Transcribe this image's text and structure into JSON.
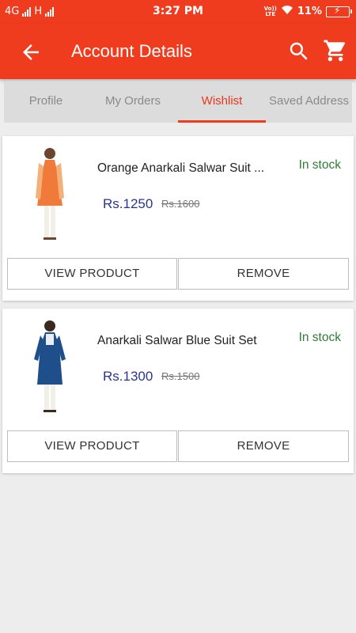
{
  "status_bar": {
    "network_left": "4G",
    "network_right": "H",
    "time": "3:27 PM",
    "volte_top": "Vo))",
    "volte_bottom": "LTE",
    "battery": "11%"
  },
  "app_bar": {
    "title": "Account Details",
    "back_icon": "arrow-back-icon",
    "search_icon": "search-icon",
    "cart_icon": "shopping-cart-icon",
    "color": "#f03c1e"
  },
  "tabs": [
    {
      "label": "Profile",
      "active": false
    },
    {
      "label": "My Orders",
      "active": false
    },
    {
      "label": "Wishlist",
      "active": true
    },
    {
      "label": "Saved Address",
      "active": false
    }
  ],
  "wishlist": [
    {
      "name": "Orange Anarkali Salwar Suit ...",
      "stock": "In stock",
      "price": "Rs.1250",
      "old_price": "Rs.1600",
      "view_label": "VIEW PRODUCT",
      "remove_label": "REMOVE",
      "image_color": "#f07a3a"
    },
    {
      "name": "Anarkali Salwar Blue Suit Set",
      "stock": "In stock",
      "price": "Rs.1300",
      "old_price": "Rs.1500",
      "view_label": "VIEW PRODUCT",
      "remove_label": "REMOVE",
      "image_color": "#1f4f8a"
    }
  ]
}
